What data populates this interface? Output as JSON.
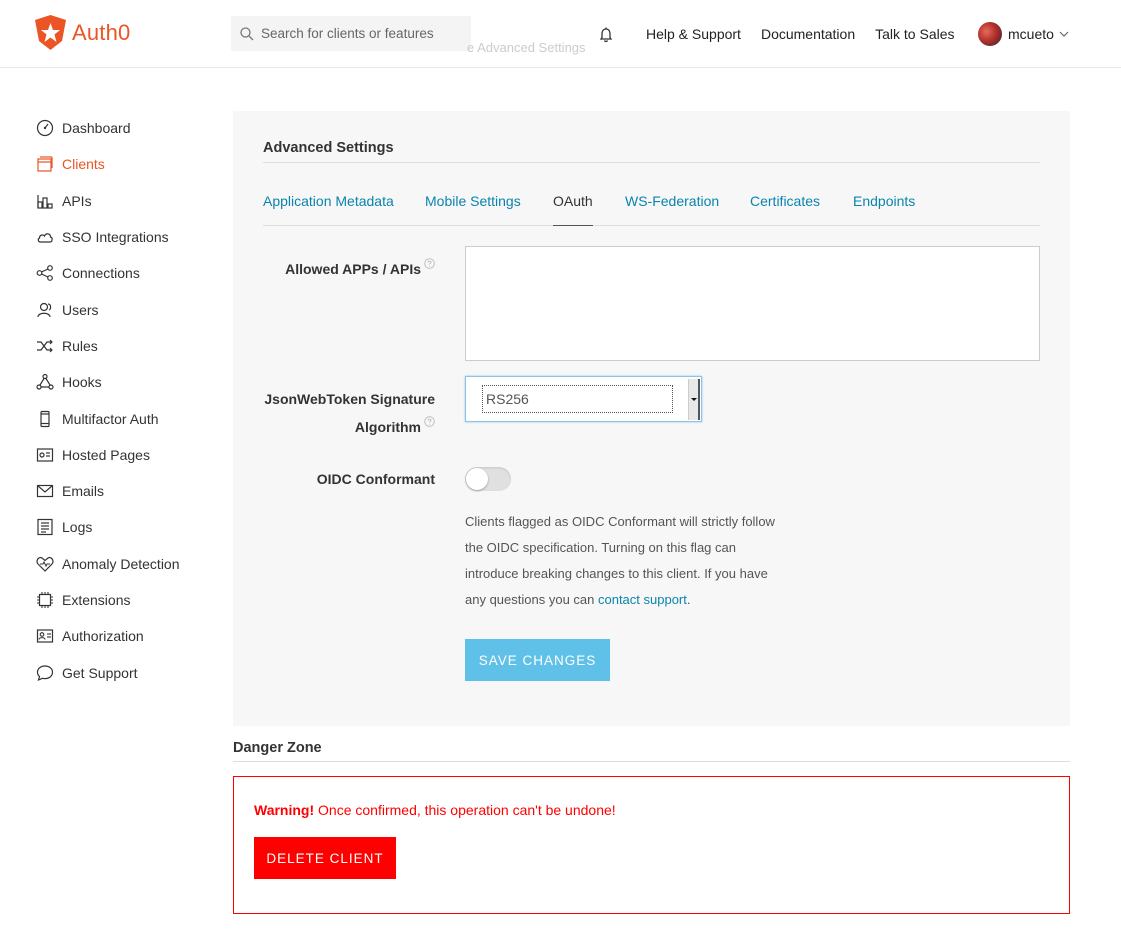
{
  "header": {
    "brand": "Auth0",
    "search_placeholder": "Search for clients or features",
    "ghost_text": "e Advanced Settings",
    "links": [
      "Help & Support",
      "Documentation",
      "Talk to Sales"
    ],
    "username": "mcueto"
  },
  "sidebar": {
    "items": [
      {
        "label": "Dashboard",
        "icon": "dashboard-icon"
      },
      {
        "label": "Clients",
        "icon": "clients-icon",
        "active": true
      },
      {
        "label": "APIs",
        "icon": "apis-icon"
      },
      {
        "label": "SSO Integrations",
        "icon": "cloud-icon"
      },
      {
        "label": "Connections",
        "icon": "connections-icon"
      },
      {
        "label": "Users",
        "icon": "users-icon"
      },
      {
        "label": "Rules",
        "icon": "rules-icon"
      },
      {
        "label": "Hooks",
        "icon": "hooks-icon"
      },
      {
        "label": "Multifactor Auth",
        "icon": "phone-icon"
      },
      {
        "label": "Hosted Pages",
        "icon": "hosted-pages-icon"
      },
      {
        "label": "Emails",
        "icon": "email-icon"
      },
      {
        "label": "Logs",
        "icon": "logs-icon"
      },
      {
        "label": "Anomaly Detection",
        "icon": "heart-icon"
      },
      {
        "label": "Extensions",
        "icon": "chip-icon"
      },
      {
        "label": "Authorization",
        "icon": "id-card-icon"
      },
      {
        "label": "Get Support",
        "icon": "chat-icon"
      }
    ]
  },
  "advanced": {
    "title": "Advanced Settings",
    "tabs": [
      {
        "label": "Application Metadata",
        "active": false
      },
      {
        "label": "Mobile Settings",
        "active": false
      },
      {
        "label": "OAuth",
        "active": true
      },
      {
        "label": "WS-Federation",
        "active": false
      },
      {
        "label": "Certificates",
        "active": false
      },
      {
        "label": "Endpoints",
        "active": false
      }
    ],
    "allowed_apps_label": "Allowed APPs / APIs",
    "allowed_apps_value": "",
    "jwt_label_line1": "JsonWebToken Signature",
    "jwt_label_line2": "Algorithm",
    "jwt_value": "RS256",
    "oidc_label": "OIDC Conformant",
    "oidc_enabled": false,
    "oidc_help_text": "Clients flagged as OIDC Conformant will strictly follow the OIDC specification. Turning on this flag can introduce breaking changes to this client. If you have any questions you can ",
    "oidc_help_link": "contact support",
    "oidc_help_end": ".",
    "save_label": "Save Changes"
  },
  "danger": {
    "title": "Danger Zone",
    "warning_strong": "Warning!",
    "warning_text": " Once confirmed, this operation can't be undone!",
    "delete_label": "Delete Client"
  },
  "colors": {
    "brand": "#eb5424",
    "link": "#0a84ae",
    "save": "#5fc1e8",
    "danger": "#ff0000"
  }
}
